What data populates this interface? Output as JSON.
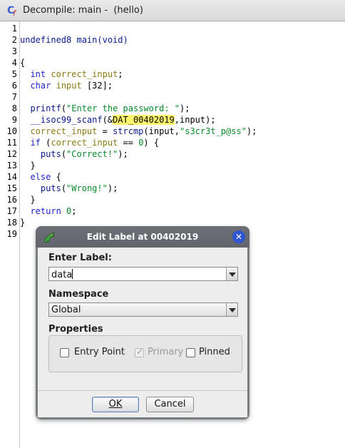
{
  "window": {
    "title": "Decompile: main -  (hello)",
    "icon": "decompile-cf-icon"
  },
  "code": {
    "line_numbers": [
      "1",
      "2",
      "3",
      "4",
      "5",
      "6",
      "7",
      "8",
      "9",
      "10",
      "11",
      "12",
      "13",
      "14",
      "15",
      "16",
      "17",
      "18",
      "19"
    ],
    "lines": [
      [],
      [
        {
          "t": "undefined8 main(void)",
          "c": "fn"
        }
      ],
      [],
      [
        {
          "t": "{",
          "c": ""
        }
      ],
      [
        {
          "t": "  ",
          "c": ""
        },
        {
          "t": "int",
          "c": "kw"
        },
        {
          "t": " ",
          "c": ""
        },
        {
          "t": "correct_input",
          "c": "var"
        },
        {
          "t": ";",
          "c": ""
        }
      ],
      [
        {
          "t": "  ",
          "c": ""
        },
        {
          "t": "char",
          "c": "kw"
        },
        {
          "t": " ",
          "c": ""
        },
        {
          "t": "input",
          "c": "var"
        },
        {
          "t": " [32];",
          "c": ""
        }
      ],
      [],
      [
        {
          "t": "  ",
          "c": ""
        },
        {
          "t": "printf",
          "c": "fn"
        },
        {
          "t": "(",
          "c": ""
        },
        {
          "t": "\"Enter the password: \"",
          "c": "str"
        },
        {
          "t": ");",
          "c": ""
        }
      ],
      [
        {
          "t": "  ",
          "c": ""
        },
        {
          "t": "__isoc99_scanf",
          "c": "fn"
        },
        {
          "t": "(&",
          "c": ""
        },
        {
          "t": "DAT_00402019",
          "c": "hl"
        },
        {
          "t": ",input);",
          "c": ""
        }
      ],
      [
        {
          "t": "  ",
          "c": ""
        },
        {
          "t": "correct_input",
          "c": "var"
        },
        {
          "t": " = ",
          "c": ""
        },
        {
          "t": "strcmp",
          "c": "fn"
        },
        {
          "t": "(input,",
          "c": ""
        },
        {
          "t": "\"s3cr3t_p@ss\"",
          "c": "str"
        },
        {
          "t": ");",
          "c": ""
        }
      ],
      [
        {
          "t": "  ",
          "c": ""
        },
        {
          "t": "if",
          "c": "kw"
        },
        {
          "t": " (",
          "c": ""
        },
        {
          "t": "correct_input",
          "c": "var"
        },
        {
          "t": " == ",
          "c": ""
        },
        {
          "t": "0",
          "c": "num"
        },
        {
          "t": ") {",
          "c": ""
        }
      ],
      [
        {
          "t": "    ",
          "c": ""
        },
        {
          "t": "puts",
          "c": "fn"
        },
        {
          "t": "(",
          "c": ""
        },
        {
          "t": "\"Correct!\"",
          "c": "str"
        },
        {
          "t": ");",
          "c": ""
        }
      ],
      [
        {
          "t": "  }",
          "c": ""
        }
      ],
      [
        {
          "t": "  ",
          "c": ""
        },
        {
          "t": "else",
          "c": "kw"
        },
        {
          "t": " {",
          "c": ""
        }
      ],
      [
        {
          "t": "    ",
          "c": ""
        },
        {
          "t": "puts",
          "c": "fn"
        },
        {
          "t": "(",
          "c": ""
        },
        {
          "t": "\"Wrong!\"",
          "c": "str"
        },
        {
          "t": ");",
          "c": ""
        }
      ],
      [
        {
          "t": "  }",
          "c": ""
        }
      ],
      [
        {
          "t": "  ",
          "c": ""
        },
        {
          "t": "return",
          "c": "kw"
        },
        {
          "t": " ",
          "c": ""
        },
        {
          "t": "0",
          "c": "num"
        },
        {
          "t": ";",
          "c": ""
        }
      ],
      [
        {
          "t": "}",
          "c": ""
        }
      ],
      []
    ]
  },
  "dialog": {
    "title": "Edit Label at 00402019",
    "icon": "ghidra-dragon-icon",
    "close_icon": "close-icon",
    "enter_label": "Enter Label:",
    "label_value": "data",
    "namespace_label": "Namespace",
    "namespace_value": "Global",
    "properties_label": "Properties",
    "entry_point": "Entry Point",
    "primary": "Primary",
    "pinned": "Pinned",
    "ok": "OK",
    "cancel": "Cancel"
  },
  "colors": {
    "keyword": "#1c23c7",
    "variable": "#8b7a14",
    "string": "#0a8a2a",
    "highlight": "#fff66e",
    "dialog_frame": "#7a7d83",
    "close_button": "#2f56d0"
  }
}
